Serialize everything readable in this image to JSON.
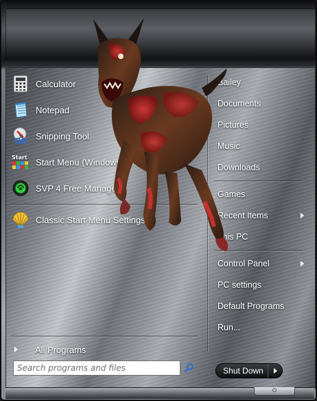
{
  "pinned": [
    {
      "label": "Calculator",
      "icon": "calculator-icon"
    },
    {
      "label": "Notepad",
      "icon": "notepad-icon"
    },
    {
      "label": "Snipping Tool",
      "icon": "snipping-tool-icon"
    },
    {
      "label": "Start Menu (Windows)",
      "icon": "start-menu-icon"
    },
    {
      "label": "SVP 4 Free Manager",
      "icon": "svp-manager-icon"
    }
  ],
  "recent": [
    {
      "label": "Classic Start Menu Settings",
      "icon": "shell-icon"
    }
  ],
  "all_programs": "All Programs",
  "search": {
    "placeholder": "Search programs and files"
  },
  "right_items": [
    {
      "label": "Bailey"
    },
    {
      "label": "Documents"
    },
    {
      "label": "Pictures"
    },
    {
      "label": "Music"
    },
    {
      "label": "Downloads"
    },
    {
      "label": "Games"
    },
    {
      "label": "Recent Items",
      "submenu": true
    },
    {
      "label": "This PC"
    },
    {
      "label": "Control Panel",
      "submenu": true
    },
    {
      "label": "PC settings"
    },
    {
      "label": "Default Programs"
    },
    {
      "label": "Run..."
    }
  ],
  "shutdown": {
    "label": "Shut Down"
  },
  "power_tab_glyph": "⏻",
  "colors": {
    "text": "#ffffff",
    "metal_light": "#c3c6ca",
    "metal_dark": "#3c3f44",
    "shutdown_bg": "#1a1b1c"
  }
}
